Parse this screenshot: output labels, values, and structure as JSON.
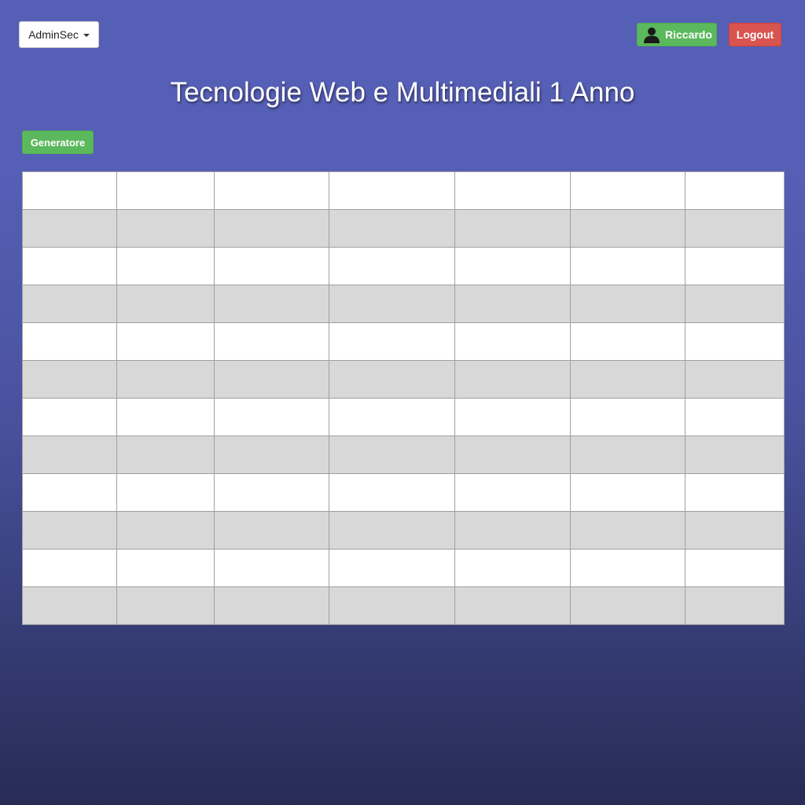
{
  "header": {
    "dropdown_label": "AdminSec",
    "user_name": "Riccardo",
    "logout_label": "Logout"
  },
  "page": {
    "title": "Tecnologie Web e Multimediali 1 Anno",
    "generator_label": "Generatore"
  },
  "icons": {
    "dropdown_caret": "chevron-down-icon",
    "user": "user-icon"
  },
  "colors": {
    "success": "#5cb85c",
    "danger": "#d9534f",
    "background_top": "#565fb6",
    "background_bottom": "#272b55",
    "row_striped": "#d8d8d8"
  },
  "table": {
    "rows": [
      [
        "",
        "",
        "",
        "",
        "",
        "",
        ""
      ],
      [
        "",
        "",
        "",
        "",
        "",
        "",
        ""
      ],
      [
        "",
        "",
        "",
        "",
        "",
        "",
        ""
      ],
      [
        "",
        "",
        "",
        "",
        "",
        "",
        ""
      ],
      [
        "",
        "",
        "",
        "",
        "",
        "",
        ""
      ],
      [
        "",
        "",
        "",
        "",
        "",
        "",
        ""
      ],
      [
        "",
        "",
        "",
        "",
        "",
        "",
        ""
      ],
      [
        "",
        "",
        "",
        "",
        "",
        "",
        ""
      ],
      [
        "",
        "",
        "",
        "",
        "",
        "",
        ""
      ],
      [
        "",
        "",
        "",
        "",
        "",
        "",
        ""
      ],
      [
        "",
        "",
        "",
        "",
        "",
        "",
        ""
      ],
      [
        "",
        "",
        "",
        "",
        "",
        "",
        ""
      ]
    ]
  }
}
